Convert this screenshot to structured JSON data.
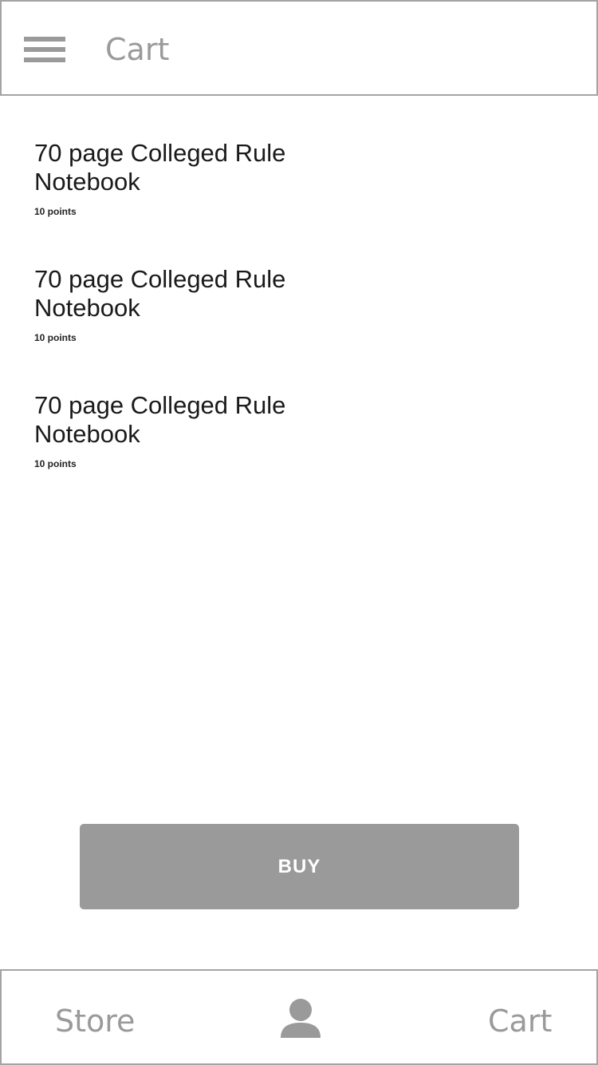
{
  "header": {
    "menu_icon": "hamburger-menu-icon",
    "title": "Cart"
  },
  "cart": {
    "items": [
      {
        "name": "70 page Colleged Rule Notebook",
        "points": "10 points"
      },
      {
        "name": "70 page Colleged Rule Notebook",
        "points": "10 points"
      },
      {
        "name": "70 page Colleged Rule Notebook",
        "points": "10 points"
      }
    ]
  },
  "buy_button": {
    "label": "BUY"
  },
  "bottom_nav": {
    "store_label": "Store",
    "profile_icon": "user-profile-icon",
    "cart_label": "Cart"
  },
  "colors": {
    "accent_gray": "#9a9a9a",
    "border_gray": "#a4a4a4",
    "text_dark": "#1a1a1a",
    "background": "#ffffff"
  }
}
